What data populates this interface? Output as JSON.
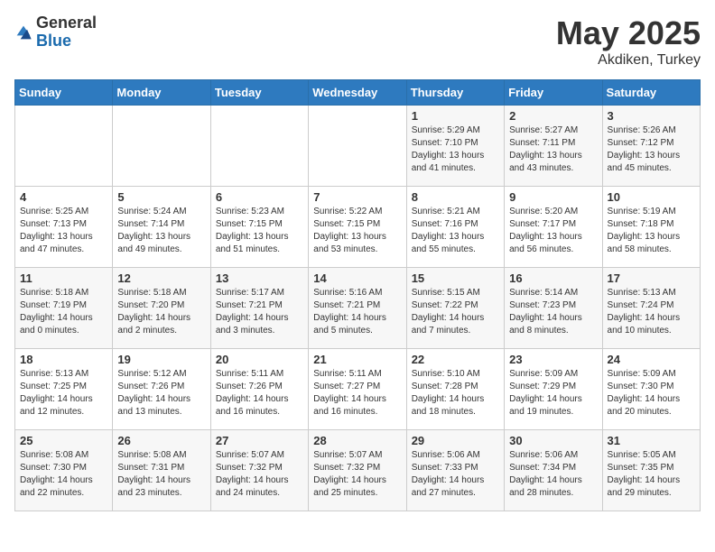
{
  "header": {
    "logo_general": "General",
    "logo_blue": "Blue",
    "month": "May 2025",
    "location": "Akdiken, Turkey"
  },
  "weekdays": [
    "Sunday",
    "Monday",
    "Tuesday",
    "Wednesday",
    "Thursday",
    "Friday",
    "Saturday"
  ],
  "weeks": [
    [
      {
        "day": "",
        "info": ""
      },
      {
        "day": "",
        "info": ""
      },
      {
        "day": "",
        "info": ""
      },
      {
        "day": "",
        "info": ""
      },
      {
        "day": "1",
        "info": "Sunrise: 5:29 AM\nSunset: 7:10 PM\nDaylight: 13 hours\nand 41 minutes."
      },
      {
        "day": "2",
        "info": "Sunrise: 5:27 AM\nSunset: 7:11 PM\nDaylight: 13 hours\nand 43 minutes."
      },
      {
        "day": "3",
        "info": "Sunrise: 5:26 AM\nSunset: 7:12 PM\nDaylight: 13 hours\nand 45 minutes."
      }
    ],
    [
      {
        "day": "4",
        "info": "Sunrise: 5:25 AM\nSunset: 7:13 PM\nDaylight: 13 hours\nand 47 minutes."
      },
      {
        "day": "5",
        "info": "Sunrise: 5:24 AM\nSunset: 7:14 PM\nDaylight: 13 hours\nand 49 minutes."
      },
      {
        "day": "6",
        "info": "Sunrise: 5:23 AM\nSunset: 7:15 PM\nDaylight: 13 hours\nand 51 minutes."
      },
      {
        "day": "7",
        "info": "Sunrise: 5:22 AM\nSunset: 7:15 PM\nDaylight: 13 hours\nand 53 minutes."
      },
      {
        "day": "8",
        "info": "Sunrise: 5:21 AM\nSunset: 7:16 PM\nDaylight: 13 hours\nand 55 minutes."
      },
      {
        "day": "9",
        "info": "Sunrise: 5:20 AM\nSunset: 7:17 PM\nDaylight: 13 hours\nand 56 minutes."
      },
      {
        "day": "10",
        "info": "Sunrise: 5:19 AM\nSunset: 7:18 PM\nDaylight: 13 hours\nand 58 minutes."
      }
    ],
    [
      {
        "day": "11",
        "info": "Sunrise: 5:18 AM\nSunset: 7:19 PM\nDaylight: 14 hours\nand 0 minutes."
      },
      {
        "day": "12",
        "info": "Sunrise: 5:18 AM\nSunset: 7:20 PM\nDaylight: 14 hours\nand 2 minutes."
      },
      {
        "day": "13",
        "info": "Sunrise: 5:17 AM\nSunset: 7:21 PM\nDaylight: 14 hours\nand 3 minutes."
      },
      {
        "day": "14",
        "info": "Sunrise: 5:16 AM\nSunset: 7:21 PM\nDaylight: 14 hours\nand 5 minutes."
      },
      {
        "day": "15",
        "info": "Sunrise: 5:15 AM\nSunset: 7:22 PM\nDaylight: 14 hours\nand 7 minutes."
      },
      {
        "day": "16",
        "info": "Sunrise: 5:14 AM\nSunset: 7:23 PM\nDaylight: 14 hours\nand 8 minutes."
      },
      {
        "day": "17",
        "info": "Sunrise: 5:13 AM\nSunset: 7:24 PM\nDaylight: 14 hours\nand 10 minutes."
      }
    ],
    [
      {
        "day": "18",
        "info": "Sunrise: 5:13 AM\nSunset: 7:25 PM\nDaylight: 14 hours\nand 12 minutes."
      },
      {
        "day": "19",
        "info": "Sunrise: 5:12 AM\nSunset: 7:26 PM\nDaylight: 14 hours\nand 13 minutes."
      },
      {
        "day": "20",
        "info": "Sunrise: 5:11 AM\nSunset: 7:26 PM\nDaylight: 14 hours\nand 16 minutes."
      },
      {
        "day": "21",
        "info": "Sunrise: 5:11 AM\nSunset: 7:27 PM\nDaylight: 14 hours\nand 16 minutes."
      },
      {
        "day": "22",
        "info": "Sunrise: 5:10 AM\nSunset: 7:28 PM\nDaylight: 14 hours\nand 18 minutes."
      },
      {
        "day": "23",
        "info": "Sunrise: 5:09 AM\nSunset: 7:29 PM\nDaylight: 14 hours\nand 19 minutes."
      },
      {
        "day": "24",
        "info": "Sunrise: 5:09 AM\nSunset: 7:30 PM\nDaylight: 14 hours\nand 20 minutes."
      }
    ],
    [
      {
        "day": "25",
        "info": "Sunrise: 5:08 AM\nSunset: 7:30 PM\nDaylight: 14 hours\nand 22 minutes."
      },
      {
        "day": "26",
        "info": "Sunrise: 5:08 AM\nSunset: 7:31 PM\nDaylight: 14 hours\nand 23 minutes."
      },
      {
        "day": "27",
        "info": "Sunrise: 5:07 AM\nSunset: 7:32 PM\nDaylight: 14 hours\nand 24 minutes."
      },
      {
        "day": "28",
        "info": "Sunrise: 5:07 AM\nSunset: 7:32 PM\nDaylight: 14 hours\nand 25 minutes."
      },
      {
        "day": "29",
        "info": "Sunrise: 5:06 AM\nSunset: 7:33 PM\nDaylight: 14 hours\nand 27 minutes."
      },
      {
        "day": "30",
        "info": "Sunrise: 5:06 AM\nSunset: 7:34 PM\nDaylight: 14 hours\nand 28 minutes."
      },
      {
        "day": "31",
        "info": "Sunrise: 5:05 AM\nSunset: 7:35 PM\nDaylight: 14 hours\nand 29 minutes."
      }
    ]
  ]
}
